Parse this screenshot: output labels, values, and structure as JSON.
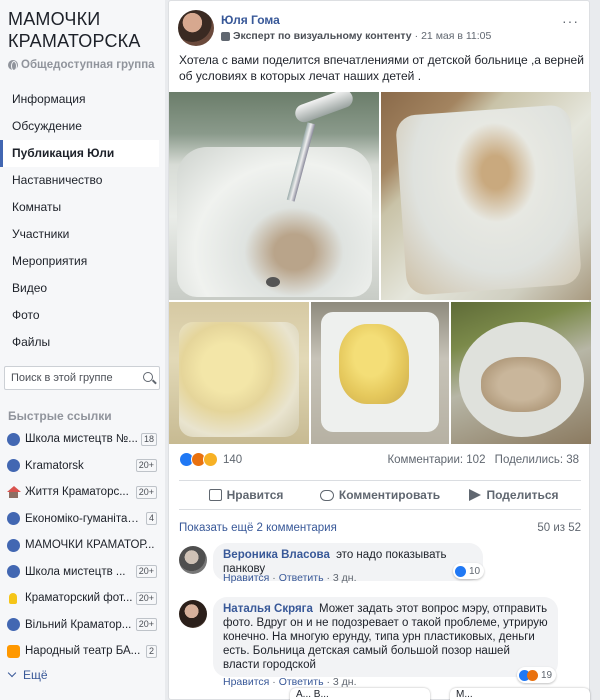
{
  "group": {
    "title": "МАМОЧКИ КРАМАТОРСКА",
    "type_label": "Общедоступная группа"
  },
  "nav": {
    "items": [
      {
        "label": "Информация"
      },
      {
        "label": "Обсуждение"
      },
      {
        "label": "Публикация Юли",
        "active": true
      },
      {
        "label": "Наставничество"
      },
      {
        "label": "Комнаты"
      },
      {
        "label": "Участники"
      },
      {
        "label": "Мероприятия"
      },
      {
        "label": "Видео"
      },
      {
        "label": "Фото"
      },
      {
        "label": "Файлы"
      }
    ]
  },
  "search": {
    "placeholder": "Поиск в этой группе"
  },
  "quick_links": {
    "title": "Быстрые ссылки",
    "items": [
      {
        "label": "Школа мистецтв №...",
        "badge": "18",
        "icon": "group-icon"
      },
      {
        "label": "Kramatorsk",
        "badge": "20+",
        "icon": "group-icon"
      },
      {
        "label": "Життя Краматорс...",
        "badge": "20+",
        "icon": "house-icon"
      },
      {
        "label": "Економіко-гуманітар...",
        "badge": "4",
        "icon": "group-icon"
      },
      {
        "label": "МАМОЧКИ КРАМАТОР...",
        "badge": "",
        "icon": "group-icon"
      },
      {
        "label": "Школа мистецтв ...",
        "badge": "20+",
        "icon": "group-icon"
      },
      {
        "label": "Краматорский фот...",
        "badge": "20+",
        "icon": "bulb-icon"
      },
      {
        "label": "Вільний Краматор...",
        "badge": "20+",
        "icon": "group-icon"
      },
      {
        "label": "Народный театр БА...",
        "badge": "2",
        "icon": "theater-icon"
      }
    ],
    "more_label": "Ещё"
  },
  "post": {
    "author": "Юля Гома",
    "expert_label": "Эксперт по визуальному контенту",
    "time": "21 мая в 11:05",
    "more": "···",
    "text": "Хотела с вами поделится впечатлениями от детской больнице ,а верней об условиях в которых лечат наших детей .",
    "reaction_count": "140",
    "comments_stat": "Комментарии: 102",
    "shares_stat": "Поделились: 38",
    "actions": {
      "like": "Нравится",
      "comment": "Комментировать",
      "share": "Поделиться"
    }
  },
  "comments": {
    "show_more": "Показать ещё 2 комментария",
    "counter": "50 из 52",
    "items": [
      {
        "author": "Вероника Власова",
        "text": "это надо показывать панкову",
        "like": "Нравится",
        "reply": "Ответить",
        "time": "3 дн.",
        "reactions": "10"
      },
      {
        "author": "Наталья Скряга",
        "text": "Может задать этот вопрос мэру, отправить фото. Вдруг он и не подозревает о такой проблеме, утрирую конечно. На многую ерунду, типа урн пластиковых, деньги есть. Больница детская самый большой позор нашей власти городской",
        "like": "Нравится",
        "reply": "Ответить",
        "time": "3 дн.",
        "reactions": "19"
      }
    ]
  },
  "chat_tabs": [
    {
      "label": "А... В..."
    },
    {
      "label": "М..."
    }
  ],
  "colors": {
    "link": "#385898",
    "accent": "#4267b2",
    "background": "#e9ebee"
  }
}
